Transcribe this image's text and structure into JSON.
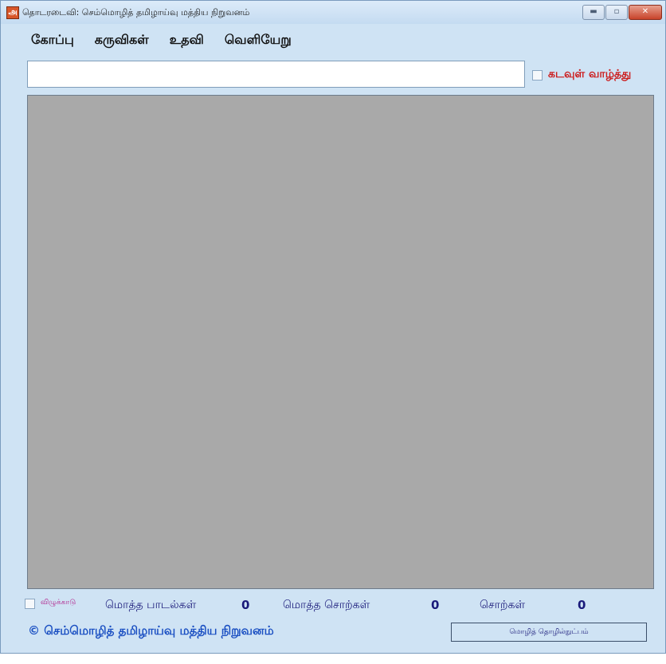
{
  "window": {
    "title": "தொடரடைவி: செம்மொழித் தமிழாய்வு மத்திய நிறுவனம்",
    "app_icon_glyph": "அ",
    "minimize_glyph": "▬",
    "maximize_glyph": "▫",
    "close_glyph": "✕"
  },
  "menu": {
    "items": [
      {
        "label": "கோப்பு"
      },
      {
        "label": "கருவிகள்"
      },
      {
        "label": "உதவி"
      },
      {
        "label": "வெளியேறு"
      }
    ]
  },
  "search": {
    "value": "",
    "invocation_label": "கடவுள் வாழ்த்து",
    "invocation_checked": false
  },
  "stats": {
    "zoom_label": "விழுக்காடு",
    "zoom_checked": false,
    "total_poems_label": "மொத்த பாடல்கள்",
    "total_poems_value": "0",
    "total_words_label": "மொத்த சொற்கள்",
    "total_words_value": "0",
    "words_label": "சொற்கள்",
    "words_value": "0"
  },
  "footer": {
    "copyright": "© செம்மொழித் தமிழாய்வு மத்திய நிறுவனம்",
    "lang_button": "மொழித் தொழில்நுட்பம்"
  },
  "colors": {
    "window_bg": "#cfe3f4",
    "display_bg": "#a9a9a9",
    "invocation_red": "#cc1a1a",
    "footer_blue": "#1a4fc2"
  }
}
